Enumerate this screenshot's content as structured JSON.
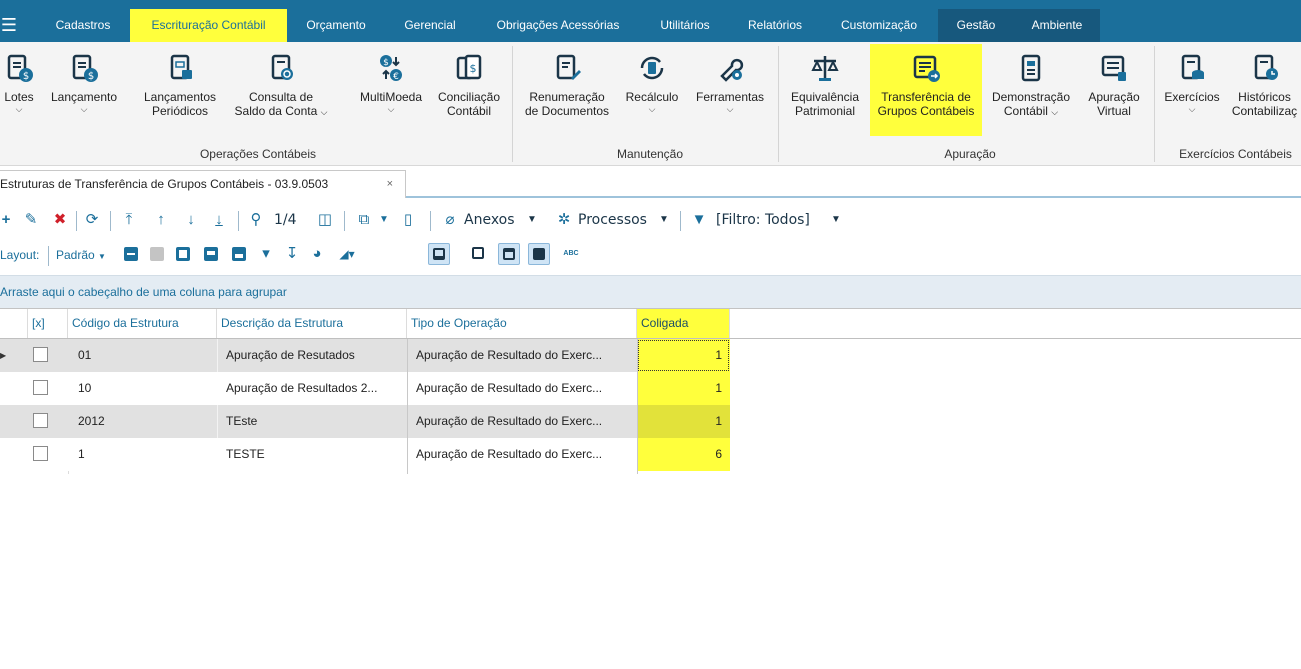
{
  "menu": {
    "items": [
      "Cadastros",
      "Escrituração Contábil",
      "Orçamento",
      "Gerencial",
      "Obrigações Acessórias",
      "Utilitários",
      "Relatórios",
      "Customização",
      "Gestão",
      "Ambiente"
    ],
    "active": "Escrituração Contábil"
  },
  "ribbon": {
    "buttons": {
      "lotes": "Lotes",
      "lancamento": "Lançamento",
      "lanc_periodicos_1": "Lançamentos",
      "lanc_periodicos_2": "Periódicos",
      "consulta_1": "Consulta de",
      "consulta_2": "Saldo da Conta",
      "multimoeda": "MultiMoeda",
      "conciliacao_1": "Conciliação",
      "conciliacao_2": "Contábil",
      "renumeracao_1": "Renumeração",
      "renumeracao_2": "de Documentos",
      "recalculo": "Recálculo",
      "ferramentas": "Ferramentas",
      "equivalencia_1": "Equivalência",
      "equivalencia_2": "Patrimonial",
      "transferencia_1": "Transferência de",
      "transferencia_2": "Grupos Contábeis",
      "demonstracao_1": "Demonstração",
      "demonstracao_2": "Contábil",
      "apuracao_virtual_1": "Apuração",
      "apuracao_virtual_2": "Virtual",
      "exercicios": "Exercícios",
      "historicos_1": "Históricos",
      "historicos_2": "Contabilizaç"
    },
    "groups": {
      "operacoes": "Operações Contábeis",
      "manutencao": "Manutenção",
      "apuracao": "Apuração",
      "exercicios": "Exercícios Contábeis"
    }
  },
  "tab": {
    "title": "Estruturas de Transferência de Grupos Contábeis - 03.9.0503",
    "close": "×"
  },
  "toolbar": {
    "record_position": "1/4",
    "anexos": "Anexos",
    "processos": "Processos",
    "filtro": "[Filtro: Todos]",
    "layout_label": "Layout:",
    "layout_value": "Padrão"
  },
  "groupbar_hint": "Arraste aqui o cabeçalho de uma coluna para agrupar",
  "grid": {
    "columns": [
      "[x]",
      "Código da Estrutura",
      "Descrição da Estrutura",
      "Tipo de Operação",
      "Coligada"
    ],
    "rows": [
      {
        "codigo": "01",
        "descricao": "Apuração de Resutados",
        "tipo": "Apuração de Resultado do Exerc...",
        "coligada": "1"
      },
      {
        "codigo": "10",
        "descricao": "Apuração de Resultados 2...",
        "tipo": "Apuração de Resultado do Exerc...",
        "coligada": "1"
      },
      {
        "codigo": "2012",
        "descricao": "TEste",
        "tipo": "Apuração de Resultado do Exerc...",
        "coligada": "1"
      },
      {
        "codigo": "1",
        "descricao": "TESTE",
        "tipo": "Apuração de Resultado do Exerc...",
        "coligada": "6"
      }
    ]
  },
  "colors": {
    "brand": "#1b6f9b",
    "highlight": "#ffff3c"
  }
}
